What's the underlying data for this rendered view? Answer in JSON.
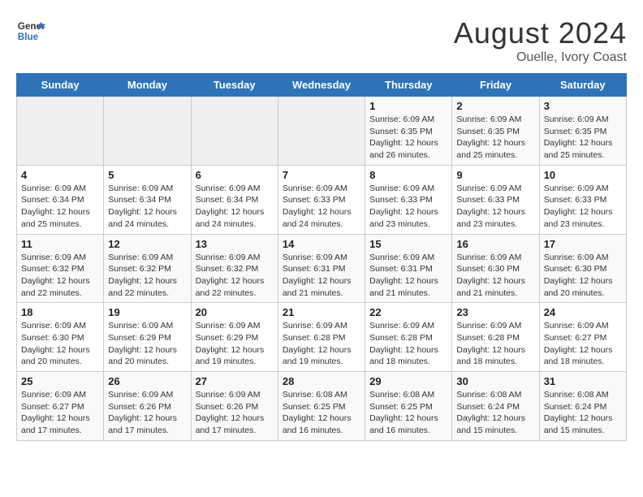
{
  "header": {
    "logo_line1": "General",
    "logo_line2": "Blue",
    "title": "August 2024",
    "subtitle": "Ouelle, Ivory Coast"
  },
  "weekdays": [
    "Sunday",
    "Monday",
    "Tuesday",
    "Wednesday",
    "Thursday",
    "Friday",
    "Saturday"
  ],
  "weeks": [
    [
      {
        "day": "",
        "info": ""
      },
      {
        "day": "",
        "info": ""
      },
      {
        "day": "",
        "info": ""
      },
      {
        "day": "",
        "info": ""
      },
      {
        "day": "1",
        "info": "Sunrise: 6:09 AM\nSunset: 6:35 PM\nDaylight: 12 hours\nand 26 minutes."
      },
      {
        "day": "2",
        "info": "Sunrise: 6:09 AM\nSunset: 6:35 PM\nDaylight: 12 hours\nand 25 minutes."
      },
      {
        "day": "3",
        "info": "Sunrise: 6:09 AM\nSunset: 6:35 PM\nDaylight: 12 hours\nand 25 minutes."
      }
    ],
    [
      {
        "day": "4",
        "info": "Sunrise: 6:09 AM\nSunset: 6:34 PM\nDaylight: 12 hours\nand 25 minutes."
      },
      {
        "day": "5",
        "info": "Sunrise: 6:09 AM\nSunset: 6:34 PM\nDaylight: 12 hours\nand 24 minutes."
      },
      {
        "day": "6",
        "info": "Sunrise: 6:09 AM\nSunset: 6:34 PM\nDaylight: 12 hours\nand 24 minutes."
      },
      {
        "day": "7",
        "info": "Sunrise: 6:09 AM\nSunset: 6:33 PM\nDaylight: 12 hours\nand 24 minutes."
      },
      {
        "day": "8",
        "info": "Sunrise: 6:09 AM\nSunset: 6:33 PM\nDaylight: 12 hours\nand 23 minutes."
      },
      {
        "day": "9",
        "info": "Sunrise: 6:09 AM\nSunset: 6:33 PM\nDaylight: 12 hours\nand 23 minutes."
      },
      {
        "day": "10",
        "info": "Sunrise: 6:09 AM\nSunset: 6:33 PM\nDaylight: 12 hours\nand 23 minutes."
      }
    ],
    [
      {
        "day": "11",
        "info": "Sunrise: 6:09 AM\nSunset: 6:32 PM\nDaylight: 12 hours\nand 22 minutes."
      },
      {
        "day": "12",
        "info": "Sunrise: 6:09 AM\nSunset: 6:32 PM\nDaylight: 12 hours\nand 22 minutes."
      },
      {
        "day": "13",
        "info": "Sunrise: 6:09 AM\nSunset: 6:32 PM\nDaylight: 12 hours\nand 22 minutes."
      },
      {
        "day": "14",
        "info": "Sunrise: 6:09 AM\nSunset: 6:31 PM\nDaylight: 12 hours\nand 21 minutes."
      },
      {
        "day": "15",
        "info": "Sunrise: 6:09 AM\nSunset: 6:31 PM\nDaylight: 12 hours\nand 21 minutes."
      },
      {
        "day": "16",
        "info": "Sunrise: 6:09 AM\nSunset: 6:30 PM\nDaylight: 12 hours\nand 21 minutes."
      },
      {
        "day": "17",
        "info": "Sunrise: 6:09 AM\nSunset: 6:30 PM\nDaylight: 12 hours\nand 20 minutes."
      }
    ],
    [
      {
        "day": "18",
        "info": "Sunrise: 6:09 AM\nSunset: 6:30 PM\nDaylight: 12 hours\nand 20 minutes."
      },
      {
        "day": "19",
        "info": "Sunrise: 6:09 AM\nSunset: 6:29 PM\nDaylight: 12 hours\nand 20 minutes."
      },
      {
        "day": "20",
        "info": "Sunrise: 6:09 AM\nSunset: 6:29 PM\nDaylight: 12 hours\nand 19 minutes."
      },
      {
        "day": "21",
        "info": "Sunrise: 6:09 AM\nSunset: 6:28 PM\nDaylight: 12 hours\nand 19 minutes."
      },
      {
        "day": "22",
        "info": "Sunrise: 6:09 AM\nSunset: 6:28 PM\nDaylight: 12 hours\nand 18 minutes."
      },
      {
        "day": "23",
        "info": "Sunrise: 6:09 AM\nSunset: 6:28 PM\nDaylight: 12 hours\nand 18 minutes."
      },
      {
        "day": "24",
        "info": "Sunrise: 6:09 AM\nSunset: 6:27 PM\nDaylight: 12 hours\nand 18 minutes."
      }
    ],
    [
      {
        "day": "25",
        "info": "Sunrise: 6:09 AM\nSunset: 6:27 PM\nDaylight: 12 hours\nand 17 minutes."
      },
      {
        "day": "26",
        "info": "Sunrise: 6:09 AM\nSunset: 6:26 PM\nDaylight: 12 hours\nand 17 minutes."
      },
      {
        "day": "27",
        "info": "Sunrise: 6:09 AM\nSunset: 6:26 PM\nDaylight: 12 hours\nand 17 minutes."
      },
      {
        "day": "28",
        "info": "Sunrise: 6:08 AM\nSunset: 6:25 PM\nDaylight: 12 hours\nand 16 minutes."
      },
      {
        "day": "29",
        "info": "Sunrise: 6:08 AM\nSunset: 6:25 PM\nDaylight: 12 hours\nand 16 minutes."
      },
      {
        "day": "30",
        "info": "Sunrise: 6:08 AM\nSunset: 6:24 PM\nDaylight: 12 hours\nand 15 minutes."
      },
      {
        "day": "31",
        "info": "Sunrise: 6:08 AM\nSunset: 6:24 PM\nDaylight: 12 hours\nand 15 minutes."
      }
    ]
  ]
}
